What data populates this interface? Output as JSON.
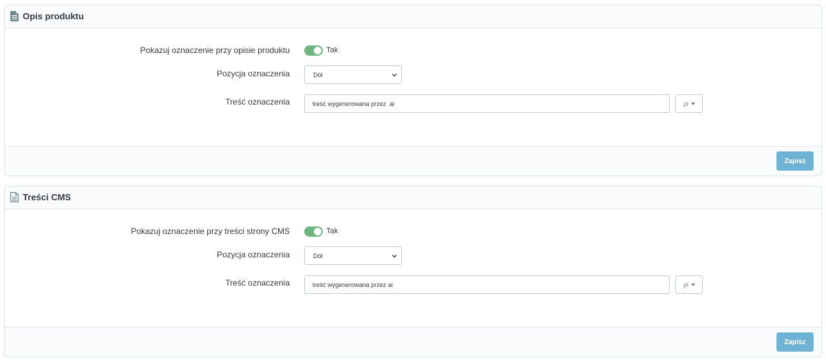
{
  "sections": [
    {
      "title": "Opis produktu",
      "icon": "document-icon",
      "show_label": "Pokazuj oznaczenie przy opisie produktu",
      "toggle_value": "Tak",
      "position_label": "Pozycja oznaczenia",
      "position_value": "Dół",
      "content_label": "Treść oznaczenia",
      "content_value": "treść wygenerowana przez  ai",
      "language": "pl",
      "save_label": "Zapisz"
    },
    {
      "title": "Treści CMS",
      "icon": "file-text-icon",
      "show_label": "Pokazuj oznaczenie przy treści strony CMS",
      "toggle_value": "Tak",
      "position_label": "Pozycja oznaczenia",
      "position_value": "Dół",
      "content_label": "Treść oznaczenia",
      "content_value": "treść wygenerowana przez ai",
      "language": "pl",
      "save_label": "Zapisz"
    }
  ],
  "colors": {
    "toggle_on": "#70b580",
    "save_button": "#6fb3d4",
    "border": "#bbcdd2"
  }
}
